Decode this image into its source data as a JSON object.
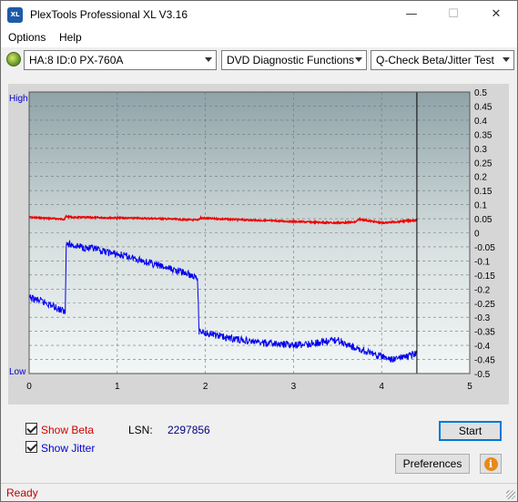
{
  "window": {
    "title": "PlexTools Professional XL V3.16",
    "icon_text": "XL",
    "minimize_glyph": "—",
    "maximize_glyph": "☐",
    "close_glyph": "✕"
  },
  "menu": [
    {
      "label": "Options"
    },
    {
      "label": "Help"
    }
  ],
  "toolbar": {
    "drive_select": "HA:8 ID:0  PX-760A",
    "function_select": "DVD Diagnostic Functions",
    "test_select": "Q-Check Beta/Jitter Test"
  },
  "chart_data": {
    "type": "line",
    "y_left_labels": {
      "top": "High",
      "bottom": "Low"
    },
    "x_ticks": [
      "0",
      "1",
      "2",
      "3",
      "4",
      "5"
    ],
    "xlim": [
      0,
      5
    ],
    "y_right_ticks": [
      "0.5",
      "0.45",
      "0.4",
      "0.35",
      "0.3",
      "0.25",
      "0.2",
      "0.15",
      "0.1",
      "0.05",
      "0",
      "-0.05",
      "-0.1",
      "-0.15",
      "-0.2",
      "-0.25",
      "-0.3",
      "-0.35",
      "-0.4",
      "-0.45",
      "-0.5"
    ],
    "ylim": [
      -0.5,
      0.5
    ],
    "grid": true,
    "end_marker_x": 4.4,
    "series": [
      {
        "color": "#ee0000",
        "x": [
          0,
          0.3,
          0.4,
          0.42,
          0.5,
          1.0,
          1.5,
          1.9,
          1.95,
          2.5,
          3.0,
          3.5,
          3.7,
          3.75,
          4.0,
          4.2,
          4.4
        ],
        "y": [
          0.055,
          0.05,
          0.048,
          0.058,
          0.055,
          0.053,
          0.05,
          0.045,
          0.052,
          0.045,
          0.04,
          0.035,
          0.038,
          0.048,
          0.035,
          0.04,
          0.045
        ]
      },
      {
        "color": "#0000ee",
        "x": [
          0,
          0.2,
          0.4,
          0.41,
          0.42,
          0.6,
          0.9,
          1.2,
          1.5,
          1.75,
          1.9,
          1.91,
          1.93,
          2.2,
          2.6,
          3.0,
          3.3,
          3.5,
          3.7,
          3.9,
          4.1,
          4.3,
          4.4
        ],
        "y": [
          -0.23,
          -0.25,
          -0.28,
          -0.28,
          -0.04,
          -0.05,
          -0.07,
          -0.09,
          -0.12,
          -0.14,
          -0.16,
          -0.16,
          -0.35,
          -0.37,
          -0.39,
          -0.4,
          -0.39,
          -0.38,
          -0.41,
          -0.43,
          -0.45,
          -0.44,
          -0.43
        ]
      }
    ]
  },
  "options": {
    "show_beta_label": "Show Beta",
    "show_jitter_label": "Show Jitter",
    "lsn_label": "LSN:",
    "lsn_value": "2297856",
    "beta_color": "#d00000",
    "jitter_color": "#0000d0"
  },
  "buttons": {
    "start": "Start",
    "preferences": "Preferences",
    "info_glyph": "i"
  },
  "status": {
    "text": "Ready"
  }
}
